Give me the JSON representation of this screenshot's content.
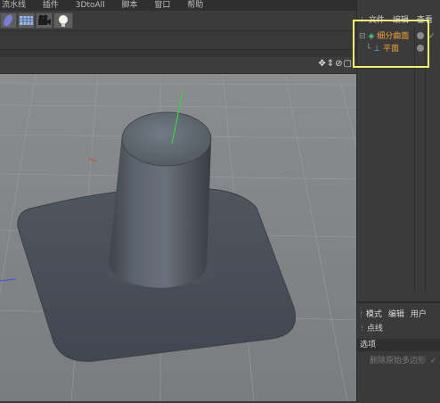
{
  "menubar": {
    "items": [
      "流水线",
      "插件",
      "3DtoAll",
      "脚本",
      "窗口",
      "帮助"
    ]
  },
  "viewport": {
    "nav_icons": "✥⇕⊘▢"
  },
  "object_manager": {
    "tabs": [
      "文件",
      "编辑",
      "查看"
    ],
    "objects": [
      {
        "name": "细分曲面",
        "color": "#f2a33a"
      },
      {
        "name": "平面",
        "color": "#f2a33a"
      }
    ],
    "check_mark": "✓"
  },
  "attribute_manager": {
    "tabs": [
      "模式",
      "编辑",
      "用户"
    ],
    "row_label": "点线",
    "section_label": "选项",
    "option_label": "删除原始多边形",
    "option_check": "✓"
  },
  "colors": {
    "highlight": "#f3f36c",
    "object_label": "#f2a33a",
    "viewport_bg": "#7f8183",
    "mesh": "#4a5058"
  }
}
